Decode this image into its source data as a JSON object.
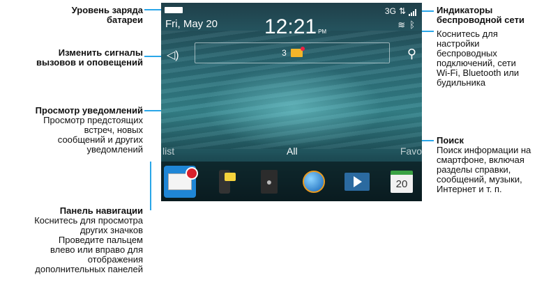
{
  "callouts": {
    "battery": {
      "title_line1": "Уровень заряда",
      "title_line2": "батареи"
    },
    "alerts": {
      "title_line1": "Изменить сигналы",
      "title_line2": "вызовов и оповещений"
    },
    "notifications": {
      "title": "Просмотр уведомлений",
      "desc_lines": [
        "Просмотр предстоящих",
        "встреч, новых",
        "сообщений и других",
        "уведомлений"
      ]
    },
    "navigation": {
      "title": "Панель навигации",
      "desc_lines": [
        "Коснитесь для просмотра",
        "других значков",
        "Проведите пальцем",
        "влево или вправо для",
        "отображения",
        "дополнительных панелей"
      ]
    },
    "wireless": {
      "title_line1": "Индикаторы",
      "title_line2": "беспроводной сети",
      "desc_lines": [
        "Коснитесь для",
        "настройки",
        "беспроводных",
        "подключений, сети",
        "Wi-Fi, Bluetooth или",
        "будильника"
      ]
    },
    "search": {
      "title": "Поиск",
      "desc_lines": [
        "Поиск информации на",
        "смартфоне, включая",
        "разделы справки,",
        "сообщений, музыки,",
        "Интернет и т. п."
      ]
    }
  },
  "screen": {
    "date": "Fri, May 20",
    "time": "12:21",
    "time_suffix": "PM",
    "network_type": "3G",
    "notification_count": "3",
    "tabs": {
      "left": "list",
      "center": "All",
      "right": "Favo"
    },
    "calendar_day": "20"
  },
  "icons": {
    "battery": "battery-icon",
    "signal": "signal-bars-icon",
    "wifi": "wifi-icon",
    "bluetooth": "bluetooth-icon",
    "speaker": "speaker-icon",
    "search": "search-icon",
    "message": "message-icon"
  },
  "colors": {
    "callout_line": "#2aa6e8",
    "selected_app": "#1f86d6"
  }
}
